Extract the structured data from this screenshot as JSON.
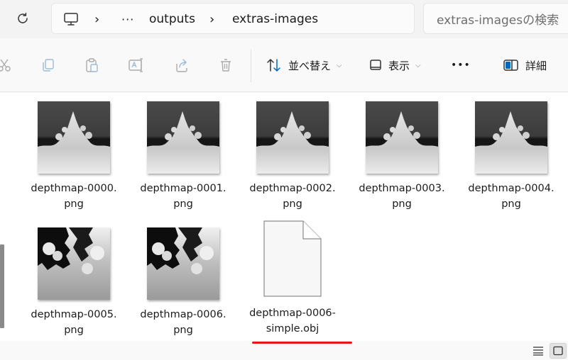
{
  "address_bar": {
    "segments": [
      "outputs",
      "extras-images"
    ],
    "overflow": "···",
    "separator": "›"
  },
  "search": {
    "placeholder": "extras-imagesの検索"
  },
  "command_bar": {
    "sort_label": "並べ替え",
    "view_label": "表示",
    "more": "•••",
    "details_label": "詳細"
  },
  "files": [
    {
      "name_line1": "depthmap-0000.",
      "name_line2": "png",
      "type": "image"
    },
    {
      "name_line1": "depthmap-0001.",
      "name_line2": "png",
      "type": "image"
    },
    {
      "name_line1": "depthmap-0002.",
      "name_line2": "png",
      "type": "image"
    },
    {
      "name_line1": "depthmap-0003.",
      "name_line2": "png",
      "type": "image"
    },
    {
      "name_line1": "depthmap-0004.",
      "name_line2": "png",
      "type": "image"
    },
    {
      "name_line1": "depthmap-0005.",
      "name_line2": "png",
      "type": "image"
    },
    {
      "name_line1": "depthmap-0006.",
      "name_line2": "png",
      "type": "image"
    },
    {
      "name_line1": "depthmap-0006-",
      "name_line2": "simple.obj",
      "type": "document"
    }
  ],
  "colors": {
    "highlight_underline": "#e8141a",
    "accent": "#0067c0"
  }
}
